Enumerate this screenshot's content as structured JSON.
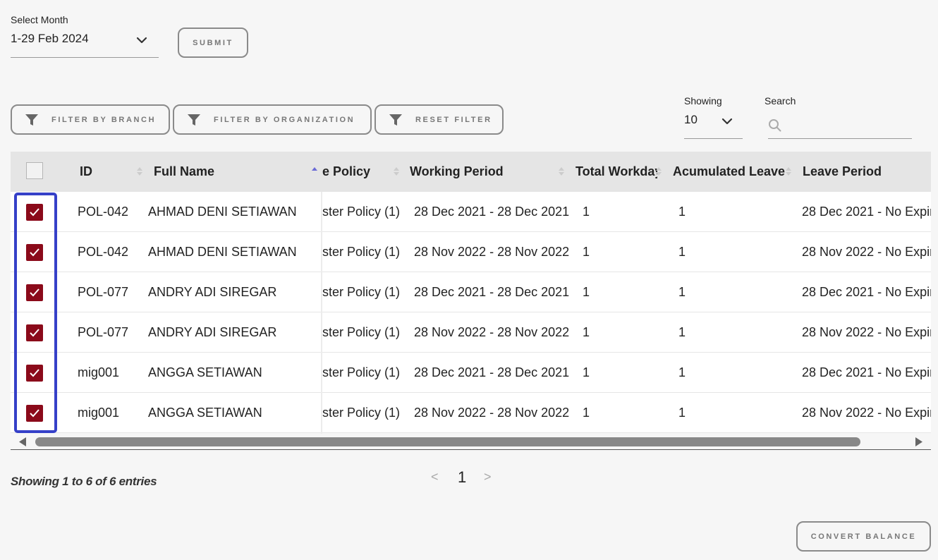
{
  "month": {
    "label": "Select Month",
    "value": "1-29 Feb 2024"
  },
  "submit_label": "SUBMIT",
  "filters": {
    "branch": "FILTER BY BRANCH",
    "organization": "FILTER BY ORGANIZATION",
    "reset": "RESET FILTER"
  },
  "showing": {
    "label": "Showing",
    "value": "10"
  },
  "search": {
    "label": "Search",
    "placeholder": ""
  },
  "table": {
    "headers": {
      "id": "ID",
      "full_name": "Full Name",
      "policy": "e Policy",
      "working_period": "Working Period",
      "total_workday": "Total Workday",
      "accumulated_leave": "Acumulated Leave",
      "leave_period": "Leave Period"
    },
    "rows": [
      {
        "id": "POL-042",
        "name": "AHMAD DENI SETIAWAN",
        "policy": "ster Policy (1)",
        "working_period": "28 Dec 2021 - 28 Dec 2021",
        "total_workday": "1",
        "accumulated_leave": "1",
        "leave_period": "28 Dec 2021 - No Expir"
      },
      {
        "id": "POL-042",
        "name": "AHMAD DENI SETIAWAN",
        "policy": "ster Policy (1)",
        "working_period": "28 Nov 2022 - 28 Nov 2022",
        "total_workday": "1",
        "accumulated_leave": "1",
        "leave_period": "28 Nov 2022 - No Expir"
      },
      {
        "id": "POL-077",
        "name": "ANDRY ADI SIREGAR",
        "policy": "ster Policy (1)",
        "working_period": "28 Dec 2021 - 28 Dec 2021",
        "total_workday": "1",
        "accumulated_leave": "1",
        "leave_period": "28 Dec 2021 - No Expir"
      },
      {
        "id": "POL-077",
        "name": "ANDRY ADI SIREGAR",
        "policy": "ster Policy (1)",
        "working_period": "28 Nov 2022 - 28 Nov 2022",
        "total_workday": "1",
        "accumulated_leave": "1",
        "leave_period": "28 Nov 2022 - No Expir"
      },
      {
        "id": "mig001",
        "name": "ANGGA SETIAWAN",
        "policy": "ster Policy (1)",
        "working_period": "28 Dec 2021 - 28 Dec 2021",
        "total_workday": "1",
        "accumulated_leave": "1",
        "leave_period": "28 Dec 2021 - No Expir"
      },
      {
        "id": "mig001",
        "name": "ANGGA SETIAWAN",
        "policy": "ster Policy (1)",
        "working_period": "28 Nov 2022 - 28 Nov 2022",
        "total_workday": "1",
        "accumulated_leave": "1",
        "leave_period": "28 Nov 2022 - No Expir"
      }
    ]
  },
  "pagination": {
    "entries_text": "Showing 1 to 6 of 6 entries",
    "prev": "<",
    "current": "1",
    "next": ">"
  },
  "convert_label": "CONVERT BALANCE",
  "colors": {
    "checkbox": "#8b0a1a",
    "highlight": "#3540c8",
    "sort_active": "#6b6bd6"
  }
}
